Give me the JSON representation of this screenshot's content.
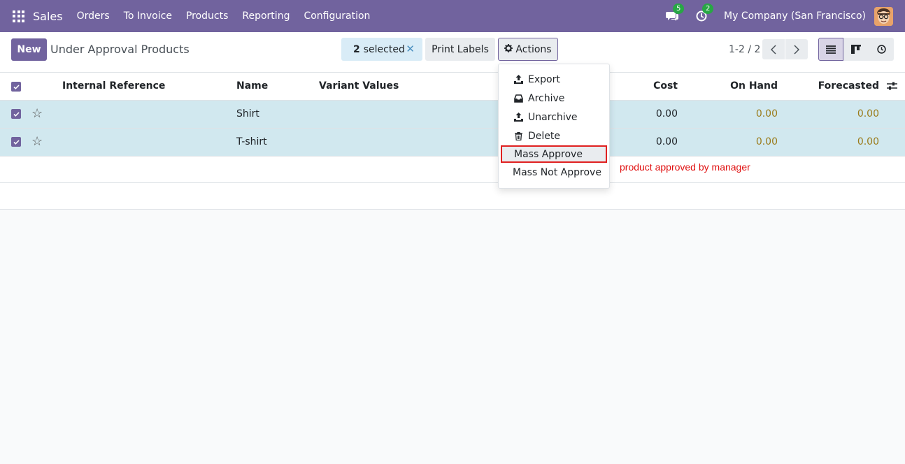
{
  "navbar": {
    "app_name": "Sales",
    "menu": [
      "Orders",
      "To Invoice",
      "Products",
      "Reporting",
      "Configuration"
    ],
    "chat_badge": "5",
    "activity_badge": "2",
    "company": "My Company (San Francisco)"
  },
  "control_panel": {
    "new_label": "New",
    "title": "Under Approval Products",
    "selected_count": "2",
    "selected_label": "selected",
    "print_labels": "Print Labels",
    "actions_label": "Actions",
    "pager": "1-2 / 2"
  },
  "table": {
    "headers": {
      "internal_reference": "Internal Reference",
      "name": "Name",
      "variant_values": "Variant Values",
      "cost": "Cost",
      "on_hand": "On Hand",
      "forecasted": "Forecasted"
    },
    "rows": [
      {
        "internal_reference": "",
        "name": "Shirt",
        "variant_values": "",
        "cost": "0.00",
        "on_hand": "0.00",
        "forecasted": "0.00"
      },
      {
        "internal_reference": "",
        "name": "T-shirt",
        "variant_values": "",
        "cost": "0.00",
        "on_hand": "0.00",
        "forecasted": "0.00"
      }
    ]
  },
  "actions_menu": {
    "items": [
      "Export",
      "Archive",
      "Unarchive",
      "Delete",
      "Mass Approve",
      "Mass Not Approve"
    ],
    "highlighted": "Mass Approve"
  },
  "annotation": "product approved by manager",
  "colors": {
    "brand": "#71639e",
    "selected_row": "#d1e8ef",
    "highlight_border": "#e02020",
    "annotation": "#e01010",
    "warning_value": "#9a7b1a"
  }
}
